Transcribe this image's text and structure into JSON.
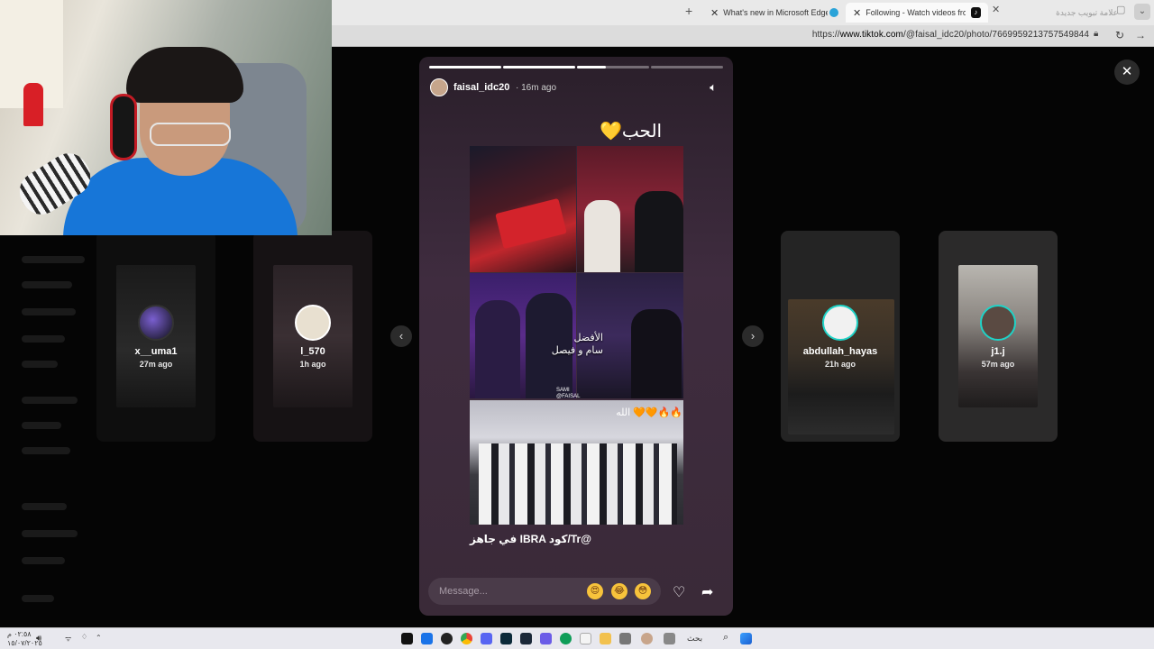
{
  "browser": {
    "tabs": [
      {
        "title": "What's new in Microsoft Edge"
      },
      {
        "title": "Following - Watch videos from cre"
      },
      {
        "title": "علامة تبويب جديدة"
      }
    ],
    "url_prefix": "https://",
    "url_domain": "www.tiktok.com",
    "url_path": "/@faisal_idc20/photo/7669959213757549844",
    "icons": [
      "plus-icon",
      "close-icon",
      "tiktok-icon",
      "edge-icon",
      "lock-icon",
      "reload-icon",
      "forward-icon"
    ]
  },
  "story": {
    "username": "faisal_idc20",
    "time": "· 16m ago",
    "title": "الحب",
    "title_emoji": "💛",
    "overlay_text_1": "الأفضل",
    "overlay_text_2": "سام و فيصل",
    "watermark": "SAMI @FAISAL",
    "overlay_text_3": "الله 🧡🧡🔥🔥",
    "caption": "في جاهز IBRA كود/Tr@",
    "message_placeholder": "Message...",
    "emojis": [
      "😍",
      "😂",
      "😳"
    ],
    "progress": [
      1,
      1,
      0.4,
      0
    ]
  },
  "side_cards": [
    {
      "name": "x__uma1",
      "time": "27m ago"
    },
    {
      "name": "l_570",
      "time": "1h ago"
    },
    {
      "name": "abdullah_hayas",
      "time": "21h ago"
    },
    {
      "name": "j1.j",
      "time": "57m ago"
    }
  ],
  "colors": {
    "accent_ring": "#1fd3c7",
    "story_bg": "#3f2c3f",
    "backdrop": "#050505"
  },
  "taskbar": {
    "time": "٠٢:٥٨ م",
    "date": "١٥/٠٧/٢٠٢٥",
    "search": "بحث"
  }
}
